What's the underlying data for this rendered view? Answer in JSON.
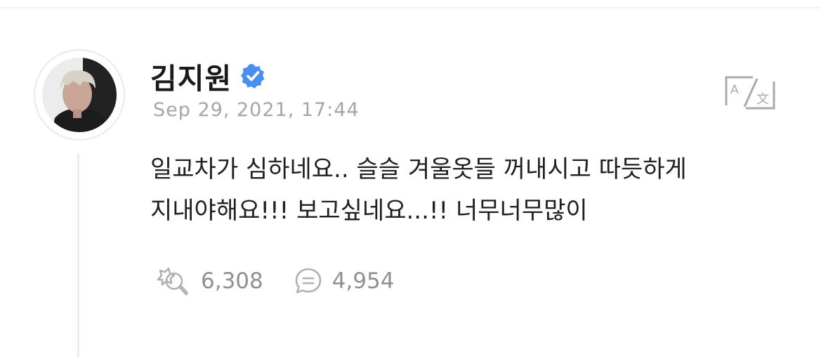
{
  "post": {
    "author": {
      "name": "김지원",
      "verified": true,
      "avatar_icon": "profile-photo"
    },
    "timestamp": "Sep 29, 2021, 17:44",
    "translate_icon": "translate-icon",
    "body_lines": [
      "일교차가 심하네요.. 슬슬 겨울옷들 꺼내시고 따듯하게",
      "지내야해요!!! 보고싶네요...!! 너무너무많이"
    ],
    "stats": {
      "likes": {
        "icon": "lightstick-like-icon",
        "value": "6,308"
      },
      "comments": {
        "icon": "comment-bubble-icon",
        "value": "4,954"
      }
    }
  },
  "colors": {
    "verified_badge": "#4a8ff0",
    "text_primary": "#1f1f1f",
    "text_secondary": "#a5a5ab",
    "stat_text": "#8f8f96"
  }
}
